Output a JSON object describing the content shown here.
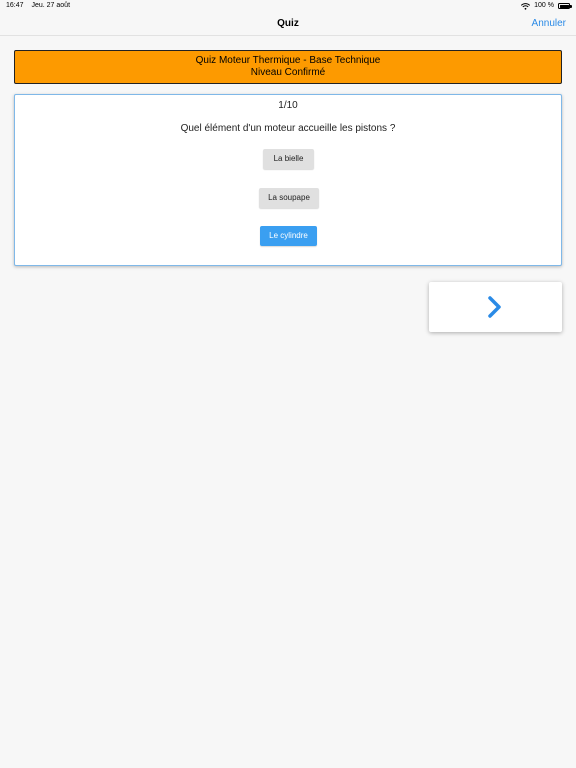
{
  "status_bar": {
    "time": "16:47",
    "date": "Jeu. 27 août",
    "battery_text": "100 %"
  },
  "nav": {
    "title": "Quiz",
    "cancel_label": "Annuler"
  },
  "quiz": {
    "title_line1": "Quiz Moteur Thermique - Base Technique",
    "title_line2": "Niveau Confirmé",
    "progress": "1/10",
    "question": "Quel élément d'un moteur accueille les pistons ?",
    "answers": [
      {
        "label": "La bielle",
        "selected": false
      },
      {
        "label": "La soupape",
        "selected": false
      },
      {
        "label": "Le cylindre",
        "selected": true
      }
    ]
  },
  "icons": {
    "next": "chevron-right-icon",
    "wifi": "wifi-icon",
    "battery": "battery-icon"
  },
  "colors": {
    "header_bg": "#fd9a00",
    "accent": "#2a8ae6",
    "selected_answer": "#3a9ff1"
  }
}
